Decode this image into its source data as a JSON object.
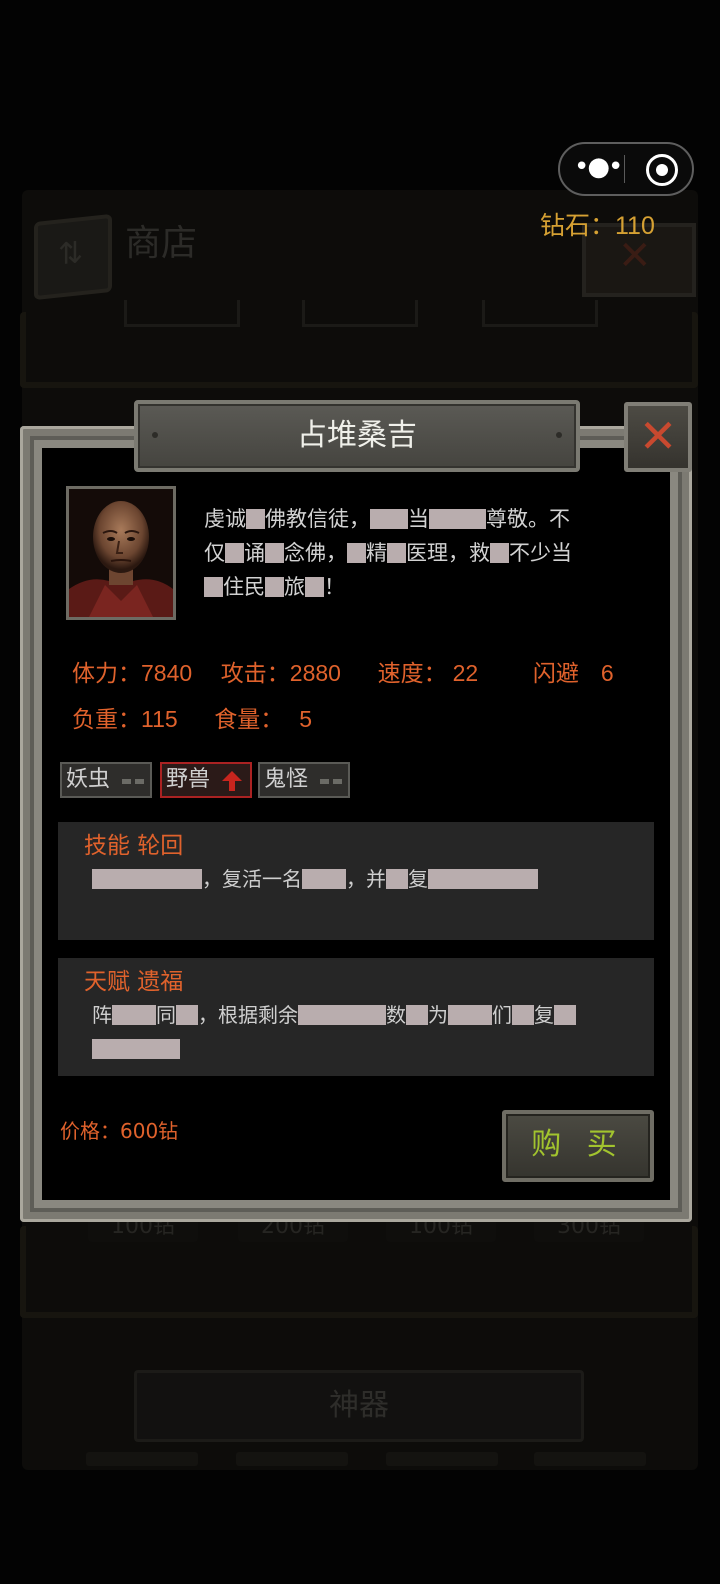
{
  "background": {
    "shop_title": "商店",
    "prices": [
      "100钻",
      "200钻",
      "100钻",
      "300钻"
    ],
    "section_label": "神器"
  },
  "diamonds": {
    "label": "钻石：110"
  },
  "dialog": {
    "title": "占堆桑吉",
    "description": [
      [
        "虔诚",
        "#",
        "佛教信徒，",
        "##",
        "当",
        "###",
        "尊敬。不"
      ],
      [
        "仅",
        "#",
        "诵",
        "#",
        "念佛，",
        "#",
        "精",
        "#",
        "医理，救",
        "#",
        "不少当"
      ],
      [
        "#",
        "住民",
        "#",
        "旅",
        "#",
        "！"
      ]
    ],
    "stats": {
      "stamina_label": "体力：",
      "stamina": "7840",
      "attack_label": "攻击：",
      "attack": "2880",
      "speed_label": "速度：",
      "speed": "22",
      "dodge_label": "闪避",
      "dodge": "6",
      "load_label": "负重：",
      "load": "115",
      "food_label": "食量：",
      "food": "5"
    },
    "tags": [
      {
        "label": "妖虫",
        "state": "neutral"
      },
      {
        "label": "野兽",
        "state": "up"
      },
      {
        "label": "鬼怪",
        "state": "neutral"
      }
    ],
    "skill": {
      "title": "技能  轮回",
      "text": [
        [
          "#####",
          "，复活一名",
          "##",
          "，并",
          "#",
          "复",
          "#####"
        ]
      ]
    },
    "talent": {
      "title": "天赋  遗福",
      "text": [
        [
          "阵",
          "##",
          "同",
          "#",
          "，根据剩余",
          "####",
          "数",
          "#",
          "为",
          "##",
          "们",
          "#",
          "复",
          "#"
        ],
        [
          "####"
        ]
      ]
    },
    "price": "价格：600钻",
    "buy_label": "购 买"
  },
  "colors": {
    "accent_orange": "#e0622c",
    "diamond_gold": "#d6a133",
    "buy_green": "#a2c42e",
    "close_red": "#c8492f",
    "redaction": "#b9adae"
  }
}
